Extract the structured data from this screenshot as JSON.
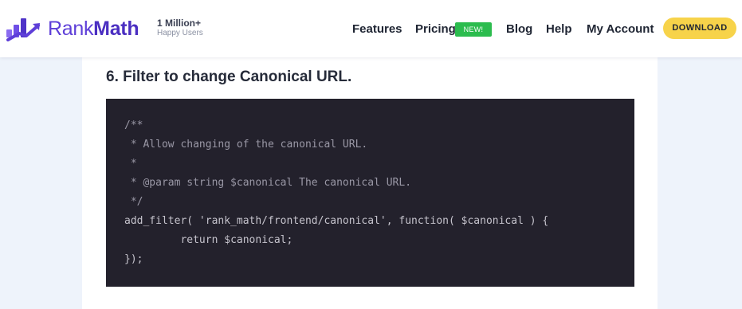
{
  "header": {
    "logo_rank": "Rank",
    "logo_math": "Math",
    "tagline_big": "1 Million+",
    "tagline_small": "Happy Users",
    "nav": {
      "features": "Features",
      "pricing": "Pricing",
      "pricing_badge": "NEW!",
      "blog": "Blog",
      "help": "Help",
      "my_account": "My Account"
    },
    "download_label": "DOWNLOAD"
  },
  "article": {
    "heading": "6. Filter to change Canonical URL.",
    "code_lines": [
      "/**",
      " * Allow changing of the canonical URL.",
      " *",
      " * @param string $canonical The canonical URL.",
      " */",
      "add_filter( 'rank_math/frontend/canonical', function( $canonical ) {",
      "\treturn $canonical;",
      "});"
    ]
  },
  "colors": {
    "brand_purple": "#5e3fd8",
    "badge_green": "#2cbc4e",
    "download_yellow": "#f7d34a",
    "code_bg": "#23212c",
    "page_bg": "#eef3fb"
  },
  "icons": {
    "logo_mark": "rankmath-bar-chart-logo-icon"
  }
}
